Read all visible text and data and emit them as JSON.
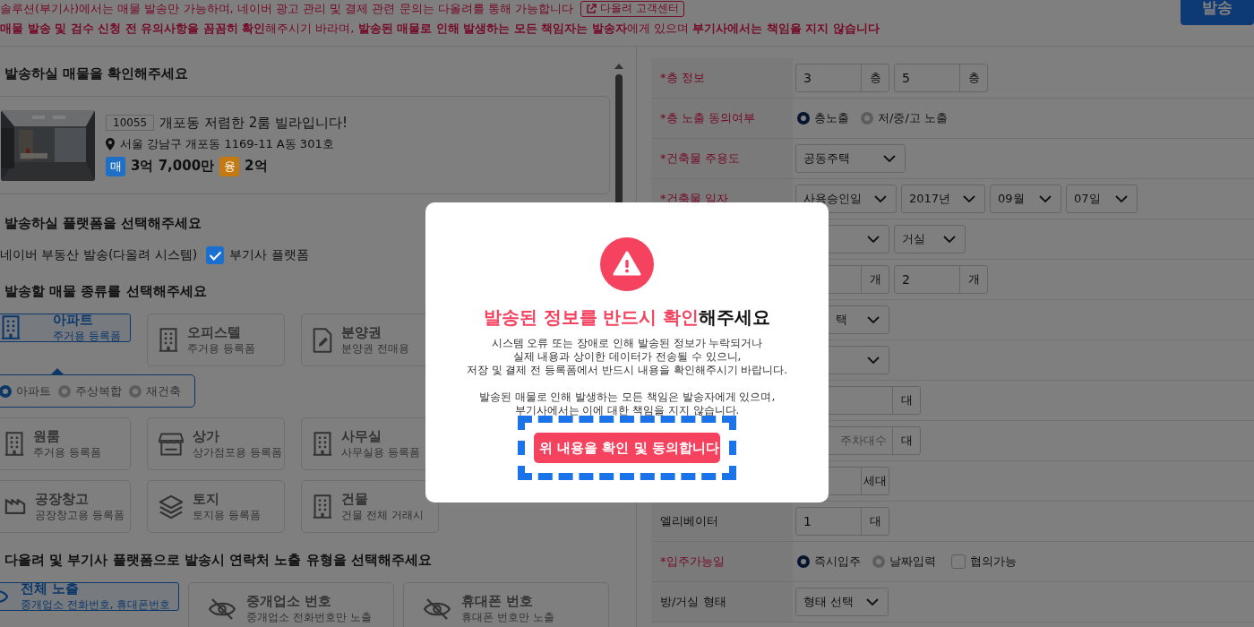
{
  "notice": {
    "lines": [
      "솔루션(부기사)에서는 매물 발송만 가능하며, 네이버 광고 관리 및 결제 관련 문의는 다올려를 통해 가능합니다",
      "**매물 발송 및 검수 신청 전 유의사항을 꼼꼼히 확인**해주시기 바라며, **발송된 매물로 인해 발생하는 모든 책임자는 발송자**에게 있으며 **부기사에서는 책임을 지지 않습니다**"
    ],
    "link": "다올려 고객센터"
  },
  "send_button": "발송",
  "property_section": {
    "title": "발송하실 매물을 확인해주세요",
    "listing": {
      "id": "10055",
      "title": "개포동 저렴한 2룸 빌라입니다!",
      "address": "서울 강남구 개포동 1169-11 A동 301호",
      "prices": [
        {
          "tag": "매",
          "value": "3억 7,000만",
          "color": "#1f6fc4"
        },
        {
          "tag": "융",
          "value": "2억",
          "color": "#c47a10"
        }
      ]
    }
  },
  "platform_section": {
    "title": "발송하실 플랫폼을 선택해주세요",
    "naver_label": "네이버 부동산 발송(다올려 시스템)",
    "option": {
      "label": "부기사 플랫폼",
      "checked": true
    }
  },
  "type_section": {
    "title": "발송할 매물 종류를 선택해주세요",
    "types": [
      {
        "name": "아파트",
        "sub": "주거용 등록폼",
        "kind": "building",
        "selected": true
      },
      {
        "name": "오피스텔",
        "sub": "주거용 등록폼",
        "kind": "building",
        "selected": false
      },
      {
        "name": "분양권",
        "sub": "분양권 전매용",
        "kind": "document",
        "selected": false
      },
      {
        "name": "원룸",
        "sub": "주거용 등록폼",
        "kind": "building",
        "selected": false
      },
      {
        "name": "상가",
        "sub": "상가점포용 등록폼",
        "kind": "store",
        "selected": false
      },
      {
        "name": "사무실",
        "sub": "사무실용 등록폼",
        "kind": "building",
        "selected": false
      },
      {
        "name": "공장창고",
        "sub": "공장창고용 등록폼",
        "kind": "factory",
        "selected": false
      },
      {
        "name": "토지",
        "sub": "토지용 등록폼",
        "kind": "layers",
        "selected": false
      },
      {
        "name": "건물",
        "sub": "건물 전체 거래시",
        "kind": "building",
        "selected": false
      }
    ],
    "subtypes": [
      {
        "label": "아파트",
        "selected": true
      },
      {
        "label": "주상복합",
        "selected": false
      },
      {
        "label": "재건축",
        "selected": false
      }
    ]
  },
  "contact_section": {
    "title": "다올려 및 부기사 플랫폼으로 발송시 연락처 노출 유형을 선택해주세요",
    "options": [
      {
        "name": "전체 노출",
        "sub": "중개업소 전화번호, 휴대폰번호",
        "selected": true
      },
      {
        "name": "중개업소 번호",
        "sub": "중개업소 전화번호만 노출",
        "selected": false
      },
      {
        "name": "휴대폰 번호",
        "sub": "휴대폰 번호만 노출",
        "selected": false
      }
    ]
  },
  "form_rows": [
    {
      "label": "*층 정보",
      "required": true,
      "controls": [
        {
          "kind": "input",
          "value": "3",
          "unit": "층"
        },
        {
          "kind": "input",
          "value": "5",
          "unit": "층"
        }
      ]
    },
    {
      "label": "*층 노출 동의여부",
      "required": true,
      "controls": [
        {
          "kind": "radio",
          "label": "층노출",
          "selected": true
        },
        {
          "kind": "radio",
          "label": "저/중/고 노출",
          "selected": false
        }
      ]
    },
    {
      "label": "*건축물 주용도",
      "required": true,
      "controls": [
        {
          "kind": "select",
          "value": "공동주택",
          "wide": true
        }
      ]
    },
    {
      "label": "*건축물 일자",
      "required": true,
      "controls": [
        {
          "kind": "select",
          "value": "사용승인일"
        },
        {
          "kind": "select",
          "value": "2017년"
        },
        {
          "kind": "select",
          "value": "09월"
        },
        {
          "kind": "select",
          "value": "07일"
        }
      ]
    },
    {
      "controls": [
        {
          "kind": "select"
        },
        {
          "kind": "select",
          "value": "거실"
        }
      ]
    },
    {
      "controls": [
        {
          "kind": "input",
          "unit": "개"
        },
        {
          "kind": "input",
          "value": "2",
          "unit": "개"
        }
      ]
    },
    {
      "controls": [
        {
          "kind": "select",
          "value": "택",
          "cut": true
        }
      ]
    },
    {
      "controls": [
        {
          "kind": "select"
        }
      ]
    },
    {
      "controls": [
        {
          "kind": "input",
          "unit": "대",
          "wide": true
        }
      ]
    },
    {
      "controls": [
        {
          "kind": "input",
          "placeholder": "주차대수",
          "unit": "대",
          "wide": true,
          "cut": true
        }
      ]
    },
    {
      "controls": [
        {
          "kind": "input",
          "unit": "세대"
        }
      ]
    },
    {
      "label": "엘리베이터",
      "required": false,
      "controls": [
        {
          "kind": "input",
          "value": "1",
          "unit": "대"
        }
      ]
    },
    {
      "label": "*입주가능일",
      "required": true,
      "controls": [
        {
          "kind": "radio",
          "label": "즉시입주",
          "selected": true
        },
        {
          "kind": "radio",
          "label": "날짜입력",
          "selected": false
        },
        {
          "kind": "checkbox",
          "label": "협의가능",
          "checked": false
        }
      ]
    },
    {
      "label": "방/거실 형태",
      "required": false,
      "controls": [
        {
          "kind": "select",
          "value": "형태 선택"
        }
      ]
    }
  ],
  "modal": {
    "title_highlight": "발송된 정보를 반드시 확인",
    "title_rest": "해주세요",
    "paragraphs": [
      [
        "시스템 오류 또는 장애로 인해 발송된 정보가 누락되거나",
        "실제 내용과 상이한 데이터가 전송될 수 있으니,",
        "저장 및 결제 전 등록폼에서 반드시 내용을 확인해주시기 바랍니다."
      ],
      [
        "발송된 매물로 인해 발생하는 모든 책임은 발송자에게 있으며,",
        "부기사에서는 이에 대한 책임을 지지 않습니다."
      ]
    ],
    "button": "위 내용을 확인 및 동의합니다"
  }
}
